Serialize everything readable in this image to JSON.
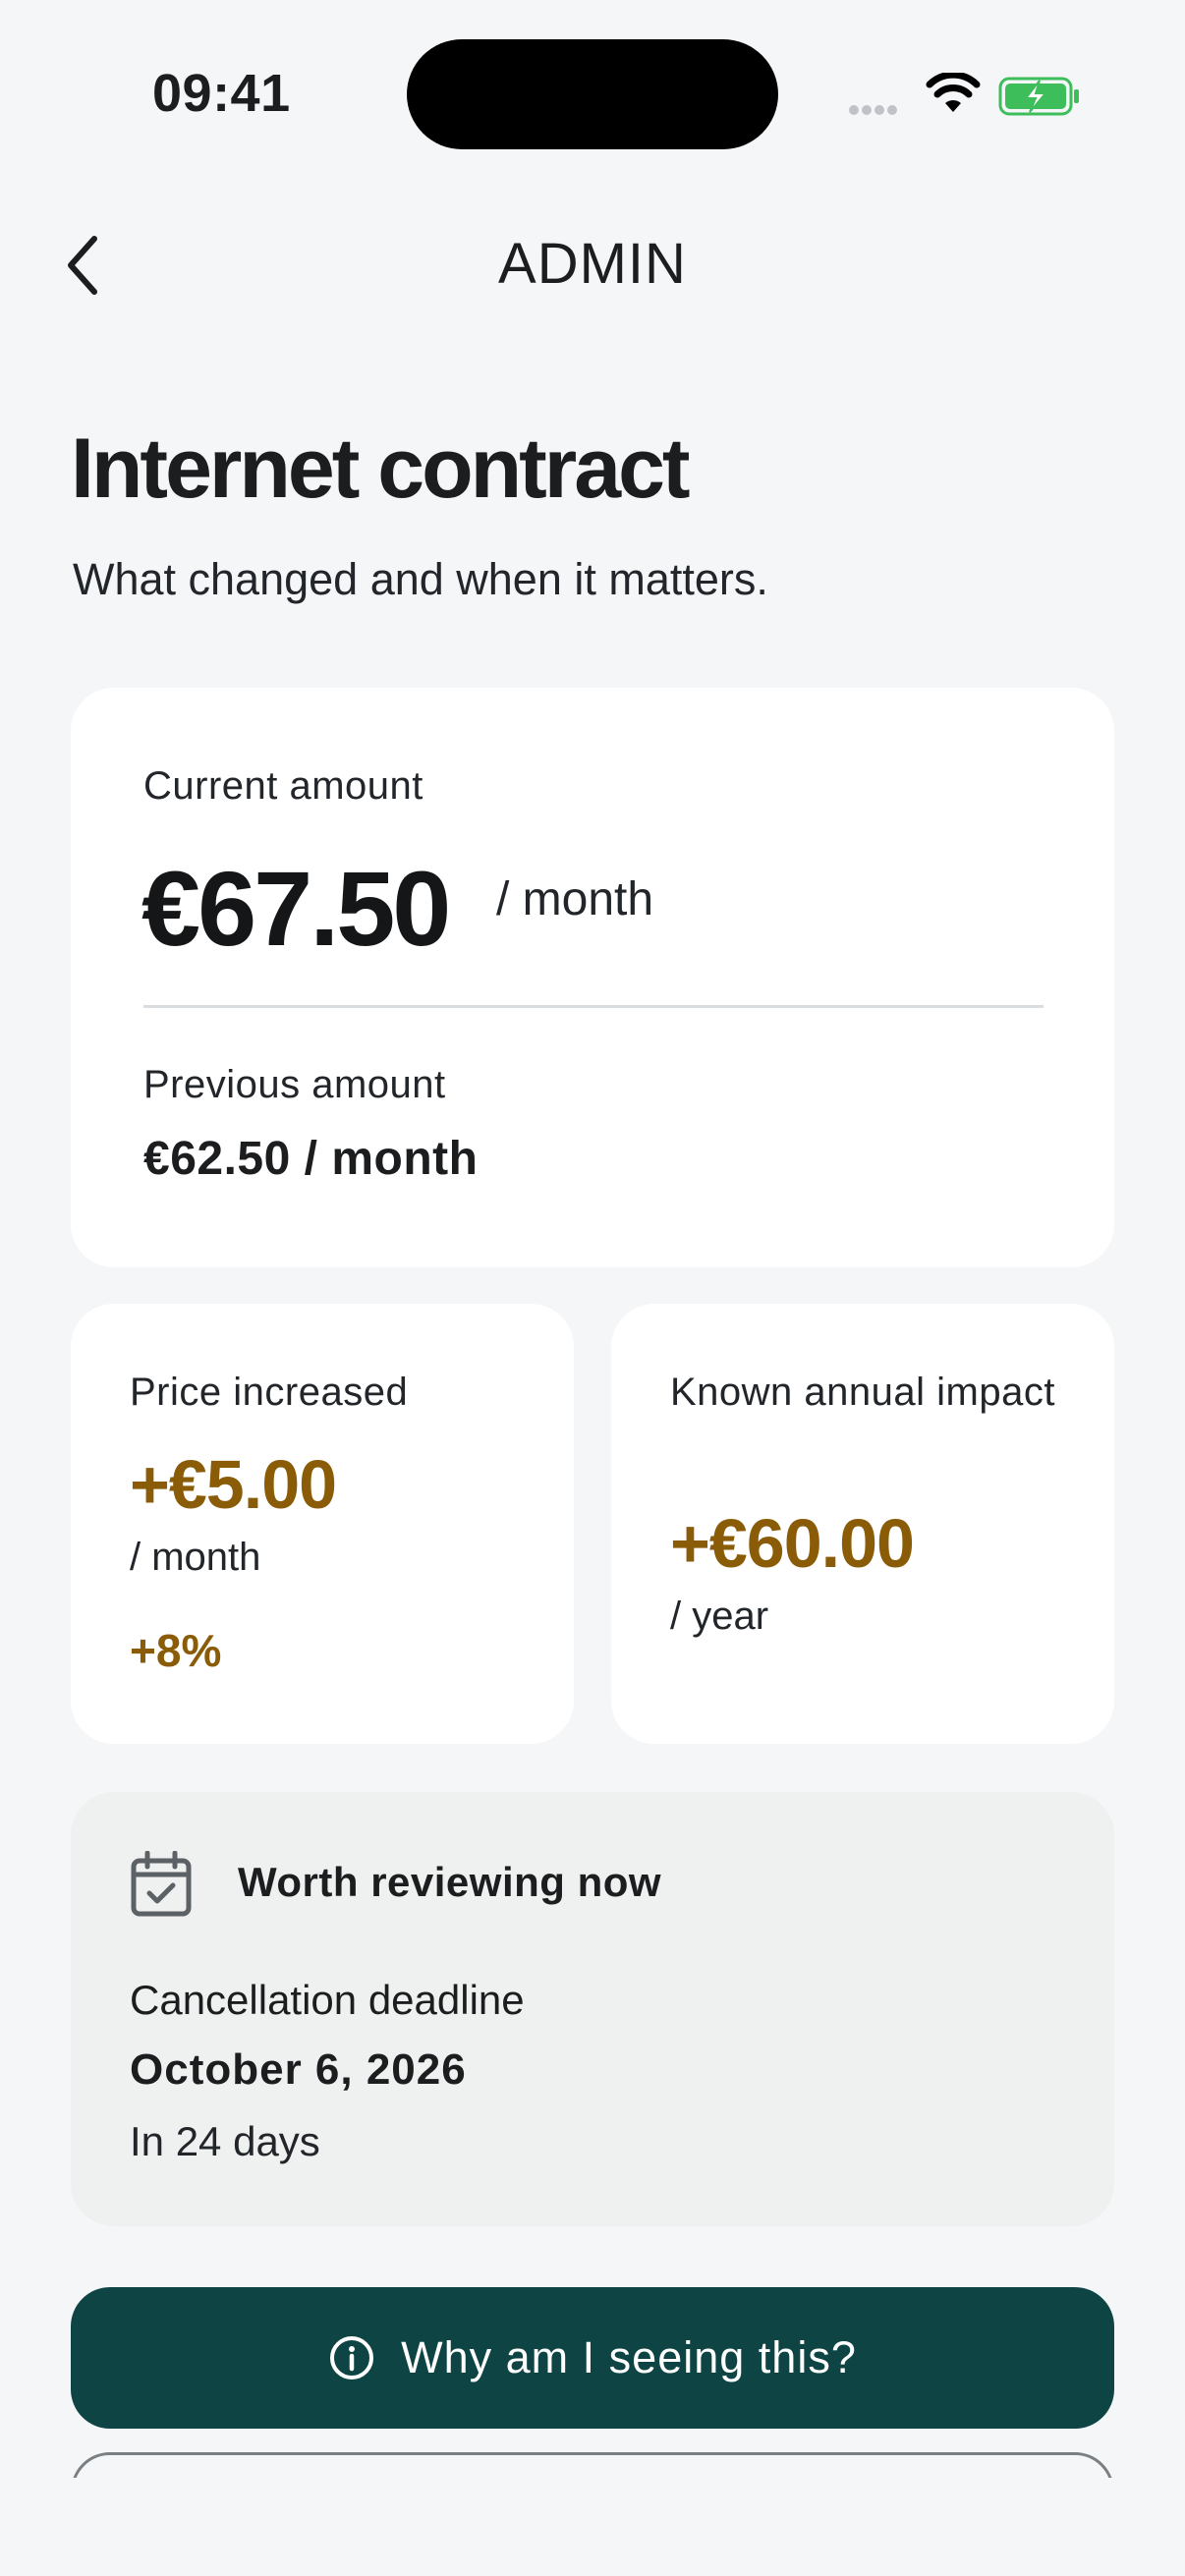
{
  "status_bar": {
    "time": "09:41"
  },
  "nav": {
    "title": "ADMIN"
  },
  "header": {
    "title": "Internet contract",
    "subtitle": "What changed and when it matters."
  },
  "amount_card": {
    "current_label": "Current amount",
    "current_amount": "€67.50",
    "current_unit": "/ month",
    "previous_label": "Previous amount",
    "previous_amount": "€62.50 / month"
  },
  "increase_card": {
    "label": "Price increased",
    "value": "+€5.00",
    "unit": "/ month",
    "percent": "+8%"
  },
  "impact_card": {
    "label": "Known annual impact",
    "value": "+€60.00",
    "unit": "/ year"
  },
  "review_card": {
    "title": "Worth reviewing now",
    "deadline_label": "Cancellation deadline",
    "deadline_date": "October 6, 2026",
    "deadline_relative": "In 24 days"
  },
  "cta": {
    "label": "Why am I seeing this?"
  },
  "colors": {
    "accent": "#0E4444",
    "increase": "#8B5C08",
    "background": "#F5F6F8",
    "card": "#FFFFFF"
  },
  "icons": {
    "back": "chevron-left-icon",
    "calendar": "calendar-check-icon",
    "info": "info-circle-icon",
    "wifi": "wifi-icon",
    "battery": "battery-charging-icon"
  }
}
